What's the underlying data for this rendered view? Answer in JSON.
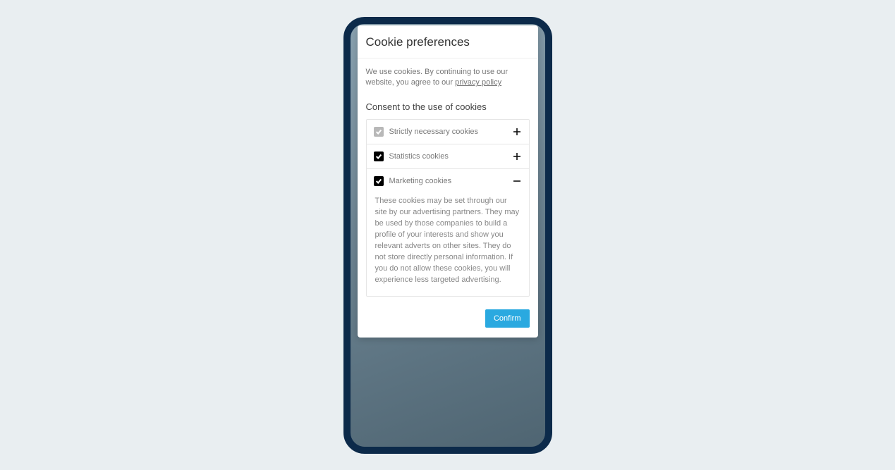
{
  "modal": {
    "title": "Cookie preferences",
    "intro_prefix": "We use cookies. By continuing to use our website, you agree to our ",
    "intro_link": "privacy policy",
    "consent_title": "Consent to the use of cookies",
    "confirm_label": "Confirm"
  },
  "categories": {
    "necessary": {
      "label": "Strictly necessary cookies"
    },
    "statistics": {
      "label": "Statistics cookies"
    },
    "marketing": {
      "label": "Marketing cookies",
      "description": "These cookies may be set through our site by our advertising partners. They may be used by those companies to build a profile of your interests and show you relevant adverts on other sites. They do not store directly personal information. If you do not allow these cookies, you will experience less targeted advertising."
    }
  }
}
